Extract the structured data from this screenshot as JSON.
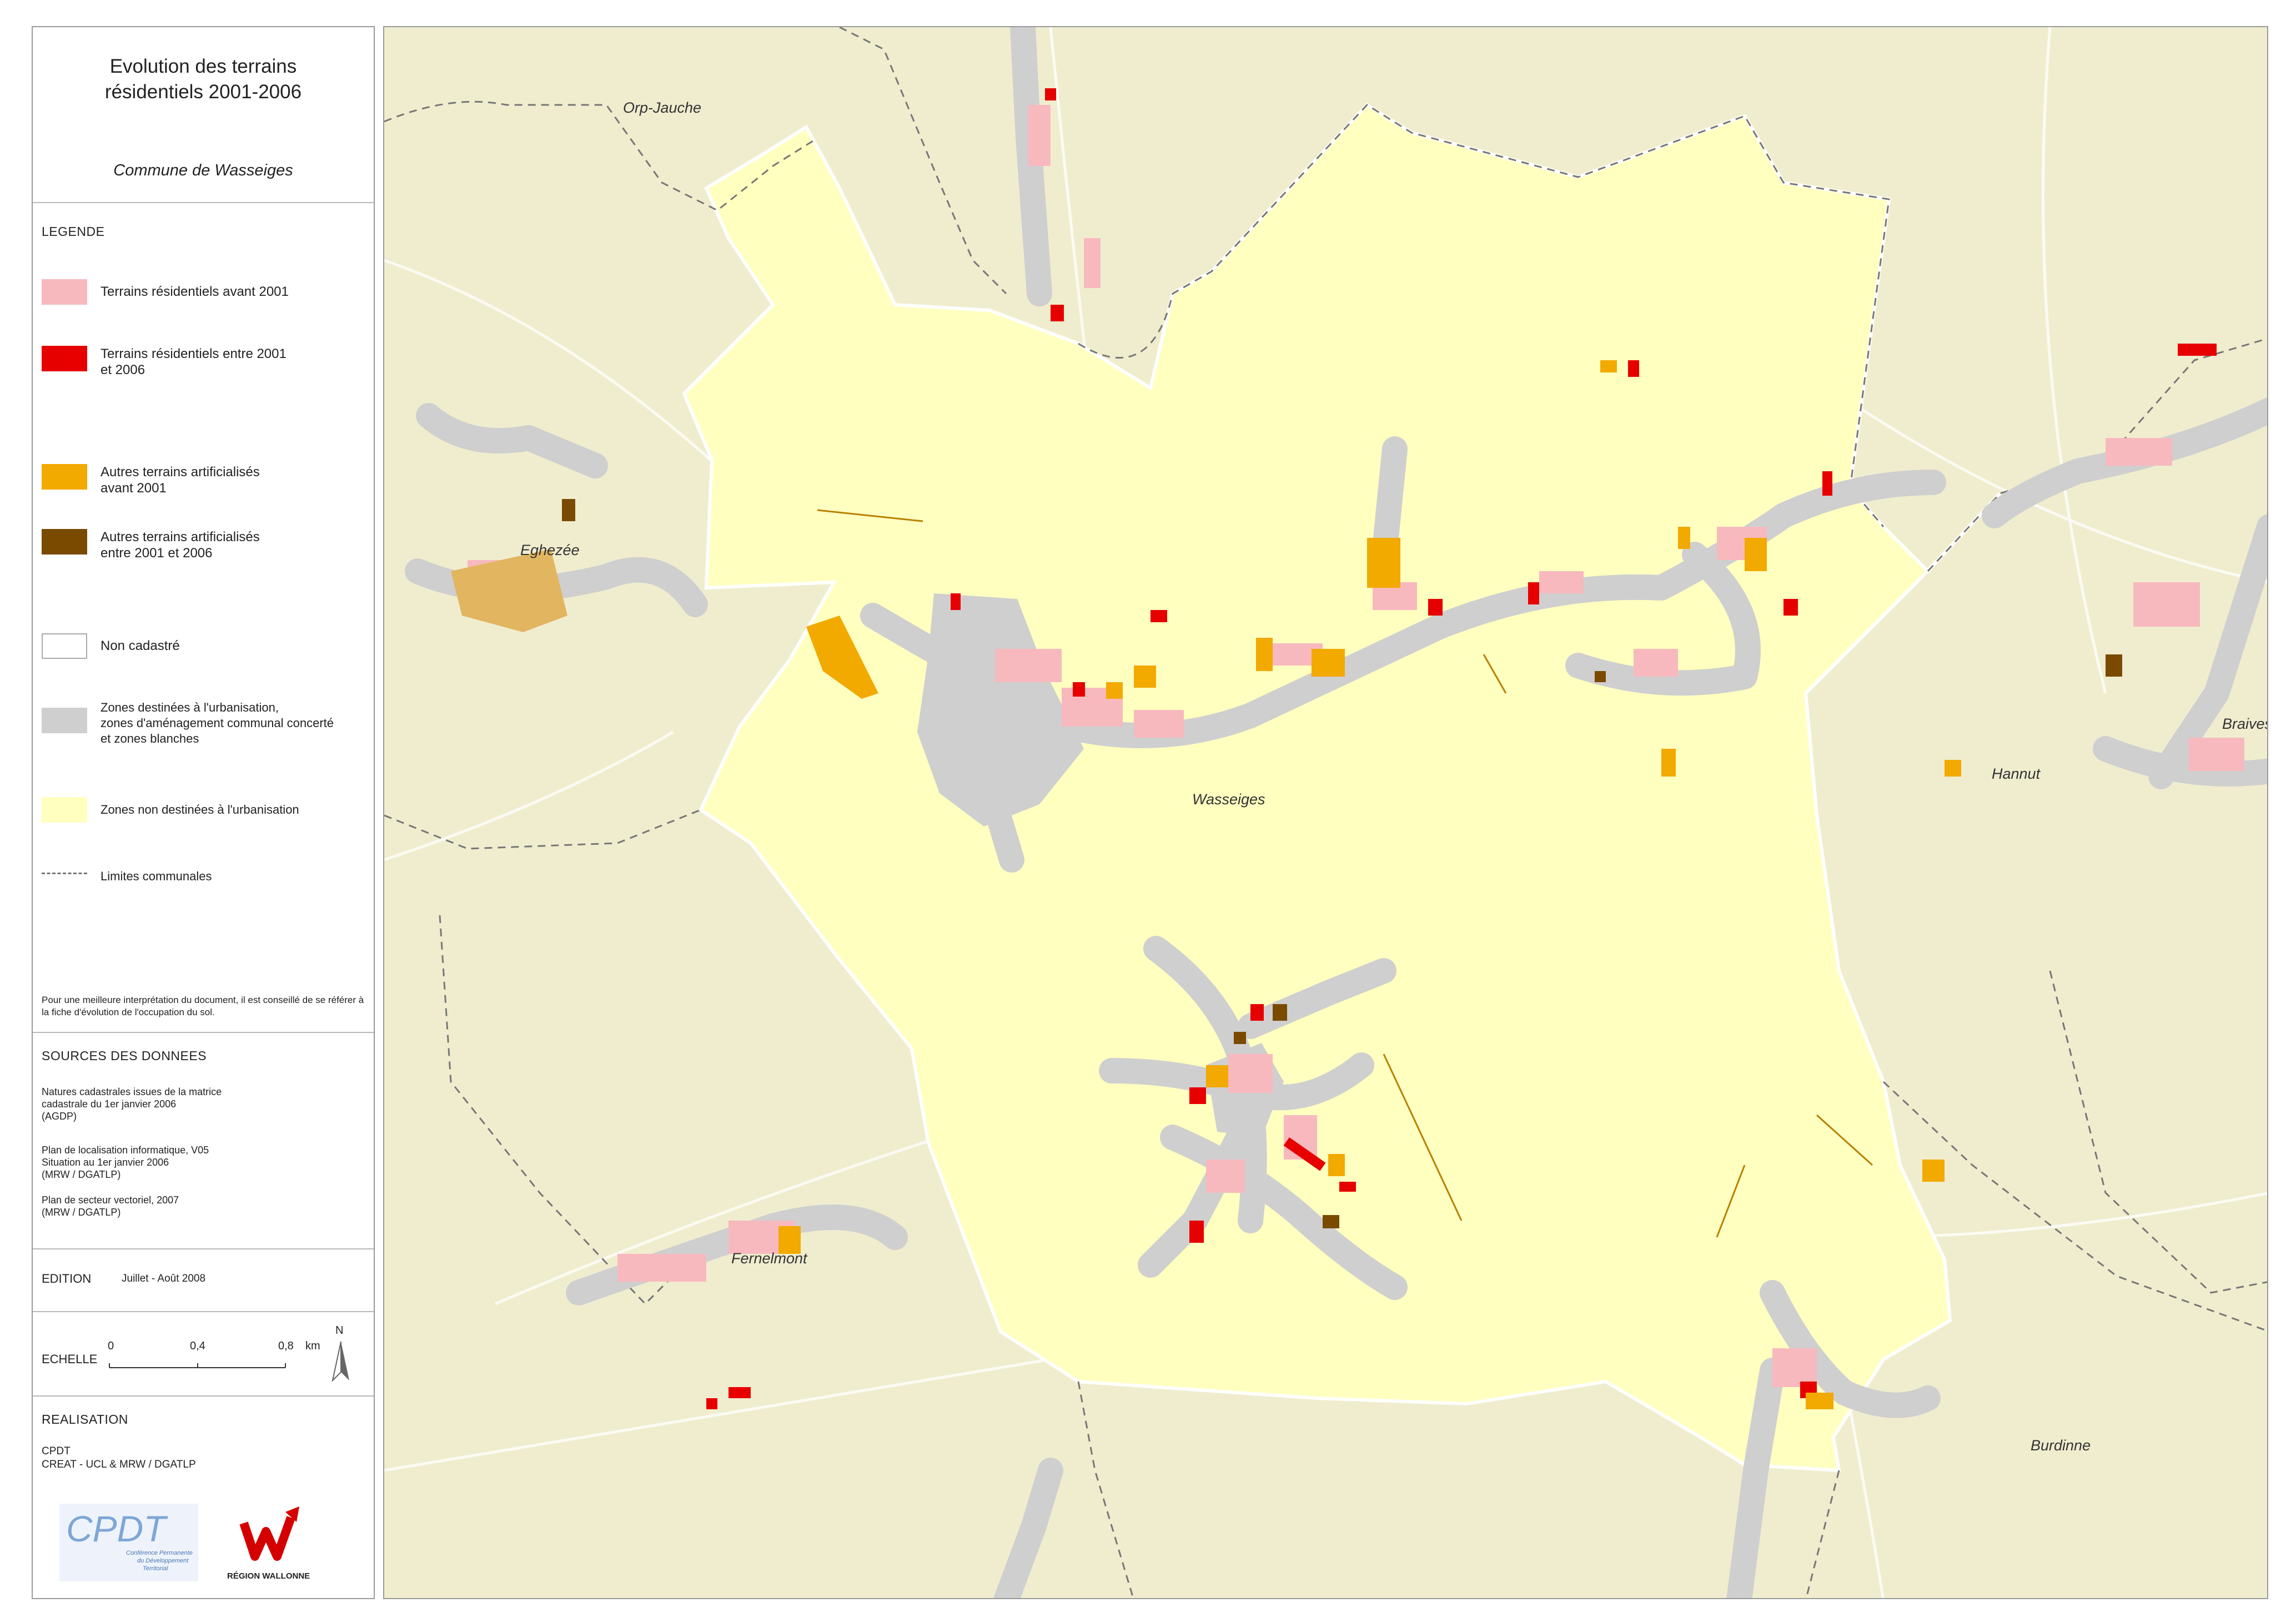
{
  "title": "Evolution des terrains\nrésidentiels 2001-2006",
  "subtitle": "Commune de Wasseiges",
  "legend": {
    "heading": "LEGENDE",
    "items": [
      {
        "label": "Terrains résidentiels avant 2001",
        "color": "#f7b9be"
      },
      {
        "label": "Terrains résidentiels entre 2001\net 2006",
        "color": "#e60000"
      },
      {
        "label": "Autres terrains artificialisés\navant 2001",
        "color": "#f2a900"
      },
      {
        "label": "Autres terrains artificialisés\nentre 2001 et 2006",
        "color": "#7a4a00"
      },
      {
        "label": "Non cadastré",
        "color": "#ffffff"
      },
      {
        "label": "Zones destinées à l'urbanisation,\nzones d'aménagement communal concerté\net zones blanches",
        "color": "#cfcfcf"
      },
      {
        "label": "Zones non destinées à l'urbanisation",
        "color": "#ffffc0"
      },
      {
        "label": "Limites communales",
        "color": "#777777"
      }
    ],
    "note": "Pour une meilleure interprétation du document, il est conseillé de se référer à la fiche d'évolution de l'occupation du sol."
  },
  "sources": {
    "heading": "SOURCES DES DONNEES",
    "entries": [
      "Natures cadastrales issues de la matrice\ncadastrale du 1er janvier 2006\n(AGDP)",
      "Plan de localisation informatique, V05\nSituation au 1er janvier 2006\n(MRW / DGATLP)",
      "Plan de secteur vectoriel, 2007\n(MRW / DGATLP)"
    ]
  },
  "edition": {
    "label": "EDITION",
    "value": "Juillet - Août 2008"
  },
  "scale": {
    "label": "ECHELLE",
    "ticks": [
      "0",
      "0,4",
      "0,8"
    ],
    "unit": "km",
    "north": "N"
  },
  "realisation": {
    "heading": "REALISATION",
    "lines": [
      "CPDT",
      "CREAT - UCL & MRW / DGATLP"
    ]
  },
  "logos": {
    "cpdt": {
      "text": "CPDT",
      "tagline": "Conférence Permanente\ndu Développement\nTerritorial"
    },
    "rw": {
      "text": "RÉGION WALLONNE"
    }
  },
  "places": [
    "Orp-Jauche",
    "Eghezée",
    "Wasseiges",
    "Hannut",
    "Braives",
    "Fernelmont",
    "Burdinne"
  ]
}
